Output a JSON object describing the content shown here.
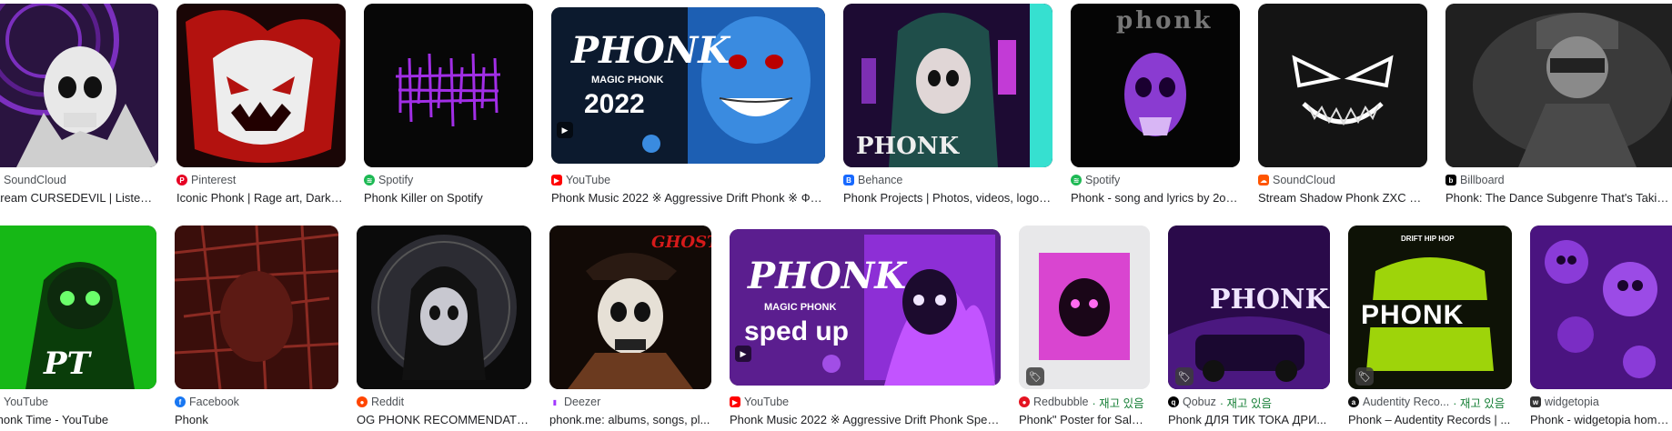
{
  "row1": [
    {
      "source": "SoundCloud",
      "caption": "Stream CURSEDEVIL | Listen ...",
      "color": "#ff5500"
    },
    {
      "source": "Pinterest",
      "caption": "Iconic Phonk | Rage art, Dark f...",
      "color": "#e60023"
    },
    {
      "source": "Spotify",
      "caption": "Phonk Killer on Spotify",
      "color": "#1db954"
    },
    {
      "source": "YouTube",
      "caption": "Phonk Music 2022 ※ Aggressive Drift Phonk ※ Фо...",
      "color": "#ff0000",
      "title": "PHONK",
      "subtitle": "MAGIC PHONK",
      "year": "2022"
    },
    {
      "source": "Behance",
      "caption": "Phonk Projects | Photos, videos, logos,...",
      "color": "#1769ff",
      "title": "PHONK"
    },
    {
      "source": "Spotify",
      "caption": "Phonk - song and lyrics by 2ou...",
      "color": "#1db954",
      "title": "phonk"
    },
    {
      "source": "SoundCloud",
      "caption": "Stream Shadow Phonk ZXC by...",
      "color": "#ff5500"
    },
    {
      "source": "Billboard",
      "caption": "Phonk: The Dance Subgenre That's Taking Of...",
      "color": "#000000"
    }
  ],
  "row2": [
    {
      "source": "YouTube",
      "caption": "Phonk Time - YouTube",
      "color": "#ff0000",
      "title": "PT"
    },
    {
      "source": "Facebook",
      "caption": "Phonk",
      "color": "#1877f2"
    },
    {
      "source": "Reddit",
      "caption": "OG PHONK RECOMMENDATIO...",
      "color": "#ff4500"
    },
    {
      "source": "Deezer",
      "caption": "phonk.me: albums, songs, pl...",
      "color": "#a238ff",
      "title": "GHOST!"
    },
    {
      "source": "YouTube",
      "caption": "Phonk Music 2022 ※ Aggressive Drift Phonk Sped ...",
      "color": "#ff0000",
      "title": "PHONK",
      "subtitle": "MAGIC PHONK",
      "year": "sped up"
    },
    {
      "source": "Redbubble",
      "stock": " · 재고 있음",
      "caption": "Phonk\" Poster for Sale ...",
      "color": "#e41321"
    },
    {
      "source": "Qobuz",
      "stock": " · 재고 있음",
      "caption": "Phonk ДЛЯ ТИК ТОКА ДРИ...",
      "color": "#000000",
      "title": "PHONK"
    },
    {
      "source": "Audentity Reco...",
      "stock": " · 재고 있음",
      "caption": "Phonk – Audentity Records | ...",
      "color": "#111111",
      "title": "PHONK",
      "subtitle": "DRIFT HIP HOP"
    },
    {
      "source": "widgetopia",
      "caption": "Phonk - widgetopia homesc...",
      "color": "#333333"
    }
  ]
}
